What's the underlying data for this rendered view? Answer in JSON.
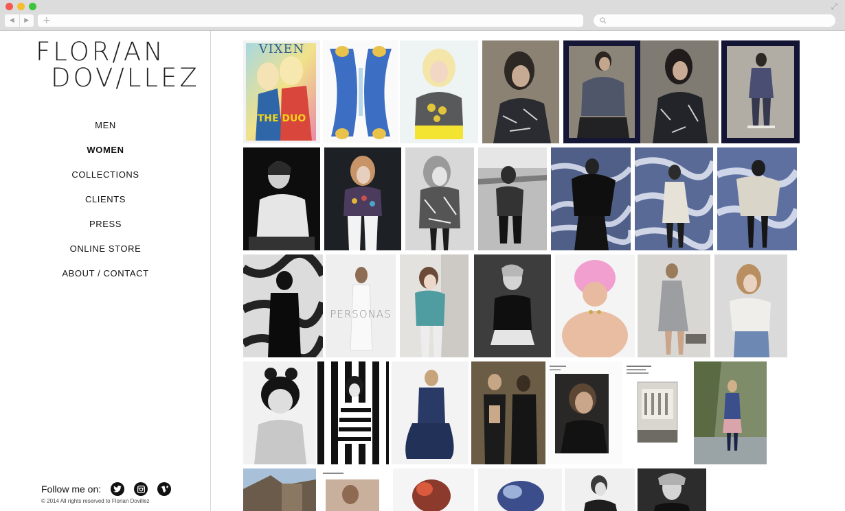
{
  "browser": {
    "back_glyph": "◀",
    "forward_glyph": "▶",
    "new_tab_glyph": "+",
    "resize_glyph": "⤢"
  },
  "site": {
    "logo_line1": "FLOR/AN",
    "logo_line2": "DOV/LLEZ"
  },
  "menu": [
    {
      "label": "MEN",
      "active": false
    },
    {
      "label": "WOMEN",
      "active": true
    },
    {
      "label": "COLLECTIONS",
      "active": false
    },
    {
      "label": "CLIENTS",
      "active": false
    },
    {
      "label": "PRESS",
      "active": false
    },
    {
      "label": "ONLINE STORE",
      "active": false
    },
    {
      "label": "ABOUT / CONTACT",
      "active": false
    }
  ],
  "footer": {
    "follow_label": "Follow me on:",
    "social_icons": [
      "twitter-icon",
      "instagram-icon",
      "vimeo-icon"
    ],
    "copyright": "© 2014 All rights reserved to Florian Dovillez"
  },
  "gallery": {
    "cover_text_1": "VIXEN",
    "cover_text_2": "THE DUO",
    "cover_text_3": "PERSONAS"
  }
}
